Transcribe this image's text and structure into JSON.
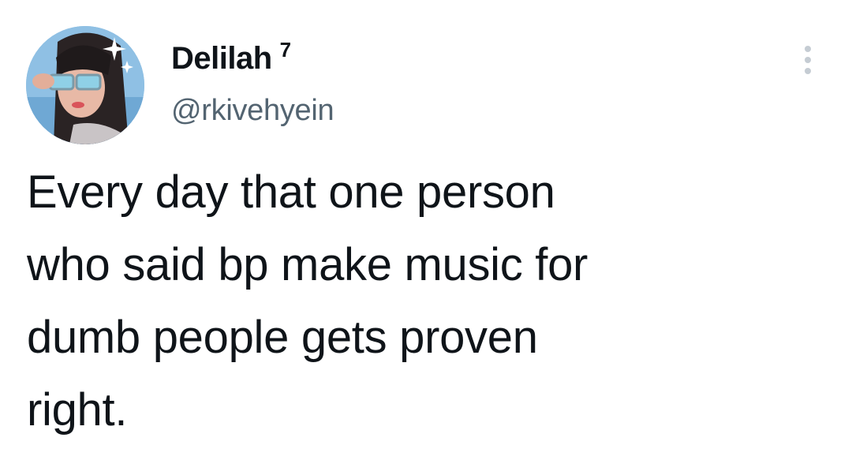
{
  "tweet": {
    "author": {
      "display_name": "Delilah",
      "name_suffix": "7",
      "handle": "@rkivehyein",
      "avatar_icon": "user-avatar-photo"
    },
    "text": "Every day that one person\nwho said bp make music for\ndumb people gets proven\nright.",
    "more_icon": "more-vertical-icon"
  },
  "colors": {
    "text_primary": "#0f1419",
    "text_secondary": "#536471",
    "icon_muted": "#c5ccd3",
    "background": "#ffffff"
  }
}
